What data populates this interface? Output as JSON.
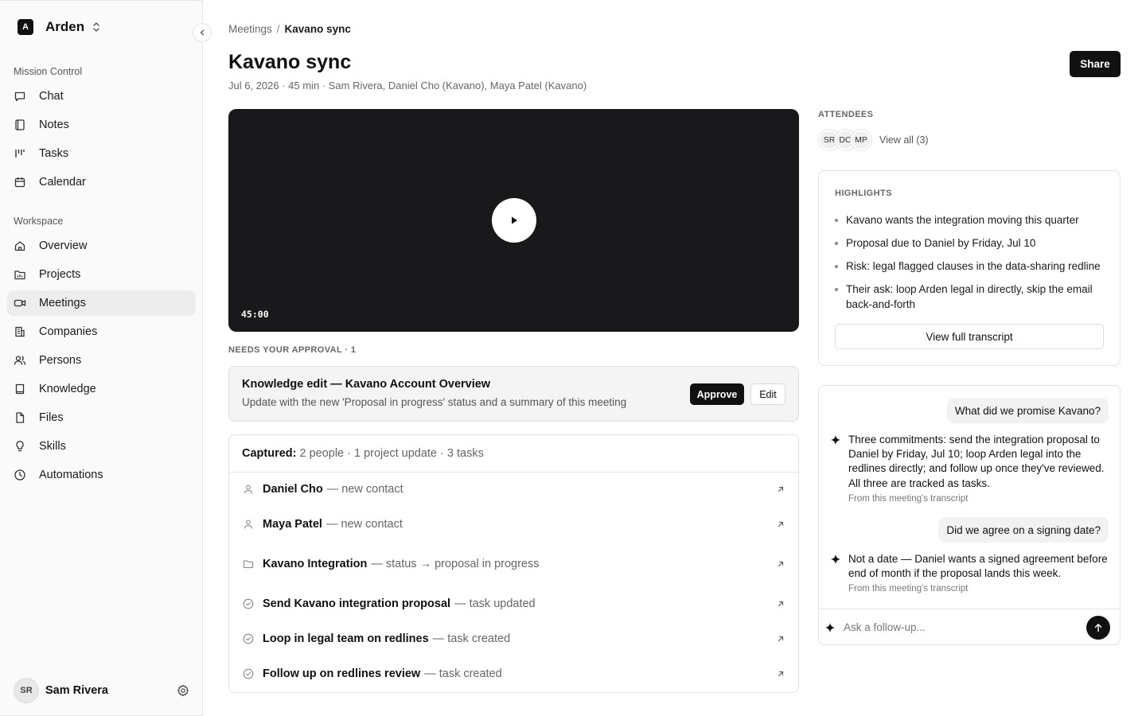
{
  "workspace": {
    "logo_letter": "A",
    "name": "Arden"
  },
  "sidebar": {
    "section1_label": "Mission Control",
    "section1_items": [
      {
        "label": "Chat",
        "icon": "chat-icon"
      },
      {
        "label": "Notes",
        "icon": "notes-icon"
      },
      {
        "label": "Tasks",
        "icon": "tasks-icon"
      },
      {
        "label": "Calendar",
        "icon": "calendar-icon"
      }
    ],
    "section2_label": "Workspace",
    "section2_items": [
      {
        "label": "Overview",
        "icon": "home-icon"
      },
      {
        "label": "Projects",
        "icon": "projects-icon"
      },
      {
        "label": "Meetings",
        "icon": "video-icon",
        "active": true
      },
      {
        "label": "Companies",
        "icon": "building-icon"
      },
      {
        "label": "Persons",
        "icon": "people-icon"
      },
      {
        "label": "Knowledge",
        "icon": "book-icon"
      },
      {
        "label": "Files",
        "icon": "file-icon"
      },
      {
        "label": "Skills",
        "icon": "lightbulb-icon"
      },
      {
        "label": "Automations",
        "icon": "clock-icon"
      }
    ]
  },
  "user": {
    "initials": "SR",
    "name": "Sam Rivera"
  },
  "breadcrumb": {
    "parent": "Meetings",
    "separator": "/",
    "current": "Kavano sync"
  },
  "meeting": {
    "title": "Kavano sync",
    "meta": "Jul 6, 2026 · 45 min · Sam Rivera, Daniel Cho (Kavano), Maya Patel (Kavano)"
  },
  "toolbar": {
    "share_label": "Share"
  },
  "video": {
    "duration": "45:00"
  },
  "approval": {
    "label": "NEEDS YOUR APPROVAL · 1",
    "title": "Knowledge edit — Kavano Account Overview",
    "description": "Update with the new 'Proposal in progress' status and a summary of this meeting",
    "approve_label": "Approve",
    "edit_label": "Edit"
  },
  "captured": {
    "label": "Captured:",
    "summary": "2 people · 1 project update · 3 tasks",
    "items": [
      {
        "name": "Daniel Cho",
        "desc": "— new contact",
        "icon": "person-icon"
      },
      {
        "name": "Maya Patel",
        "desc": "— new contact",
        "icon": "person-icon"
      },
      {
        "name": "Kavano Integration",
        "desc": "— status → proposal in progress",
        "icon": "folder-icon"
      },
      {
        "name": "Send Kavano integration proposal",
        "desc": "— task updated",
        "icon": "check-circle-icon"
      },
      {
        "name": "Loop in legal team on redlines",
        "desc": "— task created",
        "icon": "check-circle-icon"
      },
      {
        "name": "Follow up on redlines review",
        "desc": "— task created",
        "icon": "check-circle-icon"
      }
    ]
  },
  "attendees": {
    "label": "ATTENDEES",
    "initials": [
      "SR",
      "DC",
      "MP"
    ],
    "view_all": "View all (3)"
  },
  "highlights": {
    "label": "HIGHLIGHTS",
    "items": [
      "Kavano wants the integration moving this quarter",
      "Proposal due to Daniel by Friday, Jul 10",
      "Risk: legal flagged clauses in the data-sharing redline",
      "Their ask: loop Arden legal in directly, skip the email back-and-forth"
    ],
    "transcript_label": "View full transcript"
  },
  "chat": {
    "q1": "What did we promise Kavano?",
    "a1": "Three commitments: send the integration proposal to Daniel by Friday, Jul 10; loop Arden legal into the redlines directly; and follow up once they've reviewed. All three are tracked as tasks.",
    "a1_source": "From this meeting's transcript",
    "q2": "Did we agree on a signing date?",
    "a2": "Not a date — Daniel wants a signed agreement before end of month if the proposal lands this week.",
    "a2_source": "From this meeting's transcript",
    "placeholder": "Ask a follow-up..."
  },
  "colors": {
    "accent": "#111111",
    "active_nav": "#ededed",
    "video_bg": "#19191b"
  }
}
